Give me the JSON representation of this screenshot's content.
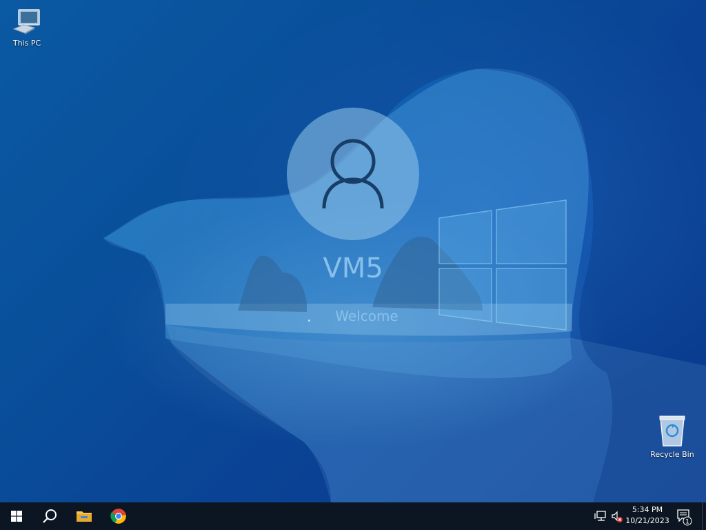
{
  "desktop": {
    "icons": [
      {
        "label": "This PC",
        "icon": "computer-icon"
      },
      {
        "label": "Recycle Bin",
        "icon": "recycle-bin-icon"
      }
    ]
  },
  "login": {
    "username": "VM5",
    "status": "Welcome",
    "avatar_icon": "user-icon"
  },
  "taskbar": {
    "start_icon": "windows-logo-icon",
    "search_icon": "search-icon",
    "pinned": [
      {
        "app": "File Explorer",
        "icon": "folder-icon"
      },
      {
        "app": "Google Chrome",
        "icon": "chrome-icon"
      }
    ],
    "tray": {
      "network_icon": "network-icon",
      "volume_icon": "volume-muted-icon",
      "time": "5:34 PM",
      "date": "10/21/2023",
      "notification_count": "1"
    }
  },
  "colors": {
    "taskbar_bg": "#0b1622",
    "wallpaper_blue": "#0a5ea9",
    "text_overlay": "#8cc3eb"
  }
}
